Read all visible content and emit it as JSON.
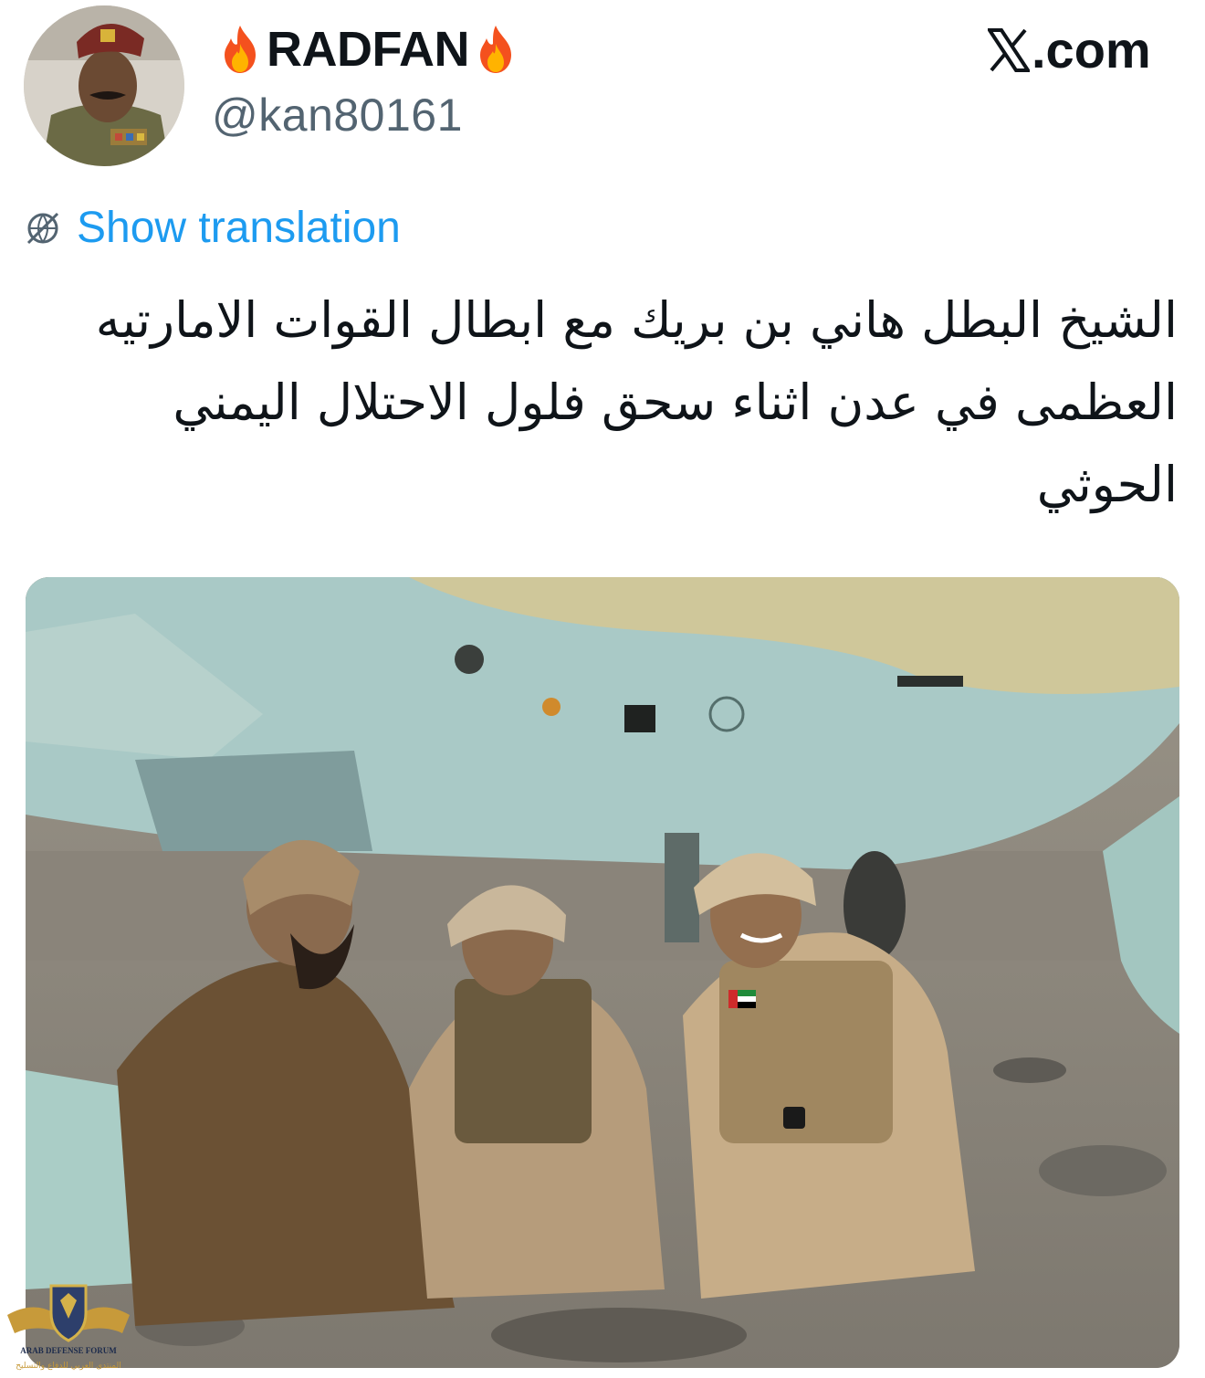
{
  "tweet": {
    "display_name": "RADFAN",
    "name_emoji": "fire-icon",
    "handle": "@kan80161",
    "brand": ".com",
    "brand_icon": "x-logo-icon",
    "translate_icon": "globe-slash-icon",
    "show_translation": "Show translation",
    "text": "الشيخ البطل هاني بن بريك مع ابطال القوات الامارتيه العظمى في عدن اثناء سحق فلول الاحتلال اليمني الحوثي"
  },
  "watermark": {
    "line1": "ARAB DEFENSE FORUM",
    "line2": "المنتدى العربي للدفاع والتسليح"
  },
  "colors": {
    "link": "#1d9bf0",
    "muted": "#536471",
    "text": "#0f1419",
    "aircraft_blue": "#a9c9c6",
    "aircraft_yellow": "#cfc79a",
    "ground": "#8f8a80"
  }
}
